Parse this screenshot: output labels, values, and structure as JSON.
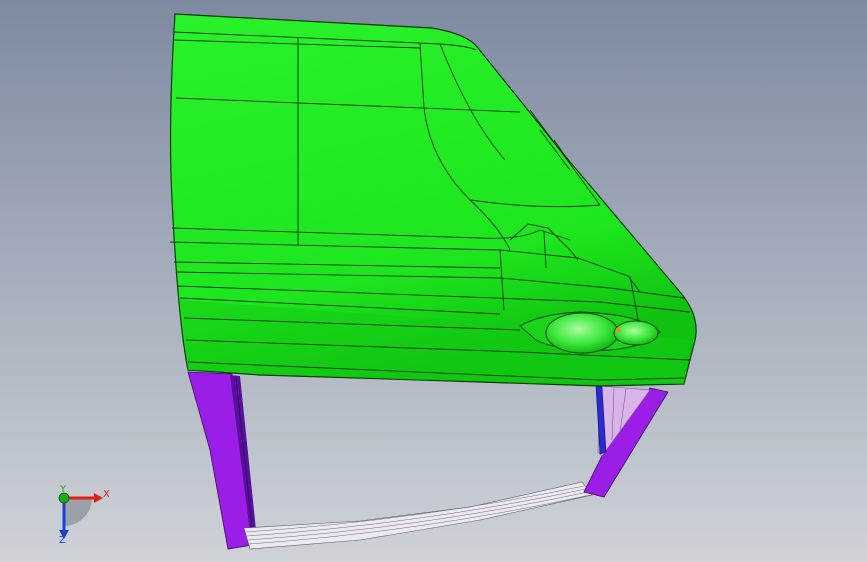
{
  "viewport": {
    "background_top": "#7d8aa0",
    "background_bottom": "#cfd3d8"
  },
  "model": {
    "shell_color": "#1ee61e",
    "shell_shade": "#12c412",
    "edge_color": "#0a3a0a",
    "pillar_color": "#9a1ee6",
    "pillar_dark": "#5a0ea0",
    "trim_color": "#e9e6ef",
    "inner_panel": "#d8b4e8",
    "lamp_color": "#44f044"
  },
  "triad": {
    "x_label": "X",
    "y_label": "Y",
    "z_label": "Z",
    "x_color": "#e0201c",
    "y_color": "#1ea81e",
    "z_color": "#1c3fd8"
  }
}
